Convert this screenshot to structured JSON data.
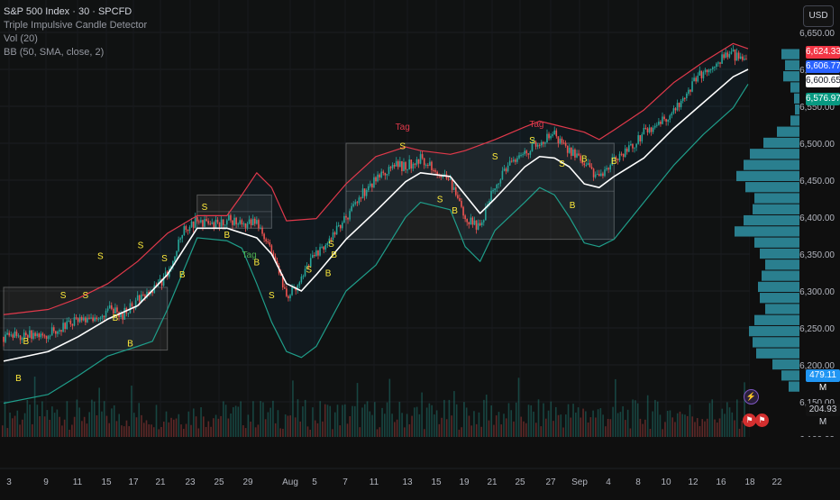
{
  "header": {
    "symbol": "S&P 500 Index · 30 · SPCFD",
    "indicator_1": "Triple Impulsive Candle Detector",
    "indicator_2": "Vol (20)",
    "indicator_3": "BB (50, SMA, close, 2)"
  },
  "currency_button": "USD",
  "price_tags": {
    "high": "6,624.33",
    "last": "6,606.77",
    "mid": "6,600.65",
    "low": "6,576.97",
    "vol_1": "479.11 M",
    "vol_2": "204.93 M"
  },
  "colors": {
    "candle_up": "#26a69a",
    "candle_down": "#ef5350",
    "bb_upper": "#e0394b",
    "bb_lower": "#1f9e8a",
    "bb_basis": "#ffffff",
    "marker_text": "#ffeb3b",
    "tag_text": "#e0394b",
    "volume_profile": "#2a7f8f"
  },
  "icons": [
    "lightning-icon",
    "flag-icon"
  ],
  "chart_data": {
    "type": "candlestick",
    "title": "",
    "ylim": [
      6100,
      6650
    ],
    "y_ticks": [
      "6,650.00",
      "6,600.00",
      "6,550.00",
      "6,500.00",
      "6,450.00",
      "6,400.00",
      "6,350.00",
      "6,300.00",
      "6,250.00",
      "6,200.00",
      "6,150.00",
      "6,100.00"
    ],
    "x_ticks": [
      "3",
      "9",
      "11",
      "15",
      "17",
      "21",
      "23",
      "25",
      "29",
      "Aug",
      "5",
      "7",
      "11",
      "13",
      "15",
      "19",
      "21",
      "25",
      "27",
      "Sep",
      "4",
      "8",
      "10",
      "12",
      "16",
      "18",
      "22"
    ],
    "close_path": [
      [
        0,
        6238
      ],
      [
        3,
        6242
      ],
      [
        5,
        6262
      ],
      [
        6,
        6258
      ],
      [
        7,
        6275
      ],
      [
        8,
        6268
      ],
      [
        9,
        6288
      ],
      [
        10,
        6300
      ],
      [
        11,
        6322
      ],
      [
        12,
        6382
      ],
      [
        13,
        6395
      ],
      [
        14,
        6388
      ],
      [
        15,
        6398
      ],
      [
        16,
        6392
      ],
      [
        17,
        6392
      ],
      [
        18,
        6355
      ],
      [
        19,
        6290
      ],
      [
        20,
        6318
      ],
      [
        21,
        6350
      ],
      [
        22,
        6372
      ],
      [
        23,
        6400
      ],
      [
        24,
        6430
      ],
      [
        25,
        6452
      ],
      [
        26,
        6470
      ],
      [
        27,
        6468
      ],
      [
        28,
        6480
      ],
      [
        29,
        6462
      ],
      [
        30,
        6445
      ],
      [
        31,
        6400
      ],
      [
        32,
        6385
      ],
      [
        33,
        6445
      ],
      [
        34,
        6470
      ],
      [
        35,
        6488
      ],
      [
        36,
        6500
      ],
      [
        37,
        6512
      ],
      [
        38,
        6490
      ],
      [
        39,
        6472
      ],
      [
        40,
        6450
      ],
      [
        41,
        6480
      ],
      [
        42,
        6492
      ],
      [
        43,
        6515
      ],
      [
        44,
        6525
      ],
      [
        45,
        6545
      ],
      [
        46,
        6572
      ],
      [
        47,
        6598
      ],
      [
        48,
        6612
      ],
      [
        49,
        6620
      ],
      [
        50,
        6606
      ]
    ],
    "bb_upper": [
      [
        0,
        6268
      ],
      [
        3,
        6275
      ],
      [
        5,
        6290
      ],
      [
        7,
        6310
      ],
      [
        9,
        6340
      ],
      [
        11,
        6378
      ],
      [
        13,
        6402
      ],
      [
        15,
        6402
      ],
      [
        16,
        6430
      ],
      [
        17,
        6460
      ],
      [
        18,
        6440
      ],
      [
        19,
        6395
      ],
      [
        21,
        6398
      ],
      [
        23,
        6445
      ],
      [
        25,
        6482
      ],
      [
        27,
        6495
      ],
      [
        28,
        6490
      ],
      [
        30,
        6485
      ],
      [
        31,
        6490
      ],
      [
        33,
        6505
      ],
      [
        35,
        6522
      ],
      [
        36,
        6530
      ],
      [
        37,
        6525
      ],
      [
        38,
        6520
      ],
      [
        39,
        6515
      ],
      [
        40,
        6505
      ],
      [
        41,
        6518
      ],
      [
        43,
        6545
      ],
      [
        45,
        6582
      ],
      [
        47,
        6610
      ],
      [
        49,
        6635
      ],
      [
        50,
        6628
      ]
    ],
    "bb_lower": [
      [
        0,
        6148
      ],
      [
        3,
        6160
      ],
      [
        5,
        6185
      ],
      [
        7,
        6212
      ],
      [
        9,
        6225
      ],
      [
        10,
        6232
      ],
      [
        11,
        6275
      ],
      [
        13,
        6372
      ],
      [
        15,
        6368
      ],
      [
        16,
        6358
      ],
      [
        17,
        6310
      ],
      [
        18,
        6258
      ],
      [
        19,
        6218
      ],
      [
        20,
        6210
      ],
      [
        21,
        6225
      ],
      [
        23,
        6300
      ],
      [
        25,
        6335
      ],
      [
        27,
        6400
      ],
      [
        28,
        6420
      ],
      [
        30,
        6410
      ],
      [
        31,
        6360
      ],
      [
        32,
        6340
      ],
      [
        33,
        6382
      ],
      [
        35,
        6420
      ],
      [
        36,
        6440
      ],
      [
        37,
        6430
      ],
      [
        38,
        6400
      ],
      [
        39,
        6365
      ],
      [
        40,
        6360
      ],
      [
        41,
        6370
      ],
      [
        43,
        6420
      ],
      [
        45,
        6470
      ],
      [
        47,
        6512
      ],
      [
        49,
        6548
      ],
      [
        50,
        6580
      ]
    ],
    "bb_basis": [
      [
        0,
        6205
      ],
      [
        3,
        6218
      ],
      [
        5,
        6238
      ],
      [
        7,
        6262
      ],
      [
        9,
        6280
      ],
      [
        11,
        6322
      ],
      [
        13,
        6385
      ],
      [
        15,
        6385
      ],
      [
        17,
        6372
      ],
      [
        18,
        6350
      ],
      [
        19,
        6310
      ],
      [
        20,
        6300
      ],
      [
        21,
        6322
      ],
      [
        23,
        6370
      ],
      [
        25,
        6408
      ],
      [
        27,
        6448
      ],
      [
        28,
        6460
      ],
      [
        30,
        6455
      ],
      [
        31,
        6430
      ],
      [
        32,
        6405
      ],
      [
        33,
        6425
      ],
      [
        35,
        6468
      ],
      [
        36,
        6482
      ],
      [
        37,
        6480
      ],
      [
        38,
        6468
      ],
      [
        39,
        6445
      ],
      [
        40,
        6440
      ],
      [
        41,
        6455
      ],
      [
        43,
        6480
      ],
      [
        45,
        6520
      ],
      [
        47,
        6555
      ],
      [
        49,
        6590
      ],
      [
        50,
        6600
      ]
    ],
    "consolidation_boxes": [
      {
        "x0": 0,
        "x1": 11,
        "y0": 6220,
        "y1": 6305
      },
      {
        "x0": 13,
        "x1": 18,
        "y0": 6385,
        "y1": 6430
      },
      {
        "x0": 23,
        "x1": 41,
        "y0": 6370,
        "y1": 6500
      }
    ],
    "markers": [
      {
        "x": 1,
        "y": 6178,
        "label": "B"
      },
      {
        "x": 1.5,
        "y": 6228,
        "label": "B"
      },
      {
        "x": 4,
        "y": 6290,
        "label": "S"
      },
      {
        "x": 5.5,
        "y": 6290,
        "label": "S"
      },
      {
        "x": 7.5,
        "y": 6260,
        "label": "B"
      },
      {
        "x": 8.5,
        "y": 6225,
        "label": "B"
      },
      {
        "x": 6.5,
        "y": 6343,
        "label": "S"
      },
      {
        "x": 9.2,
        "y": 6358,
        "label": "S"
      },
      {
        "x": 10.8,
        "y": 6340,
        "label": "S"
      },
      {
        "x": 12,
        "y": 6318,
        "label": "B"
      },
      {
        "x": 13.5,
        "y": 6410,
        "label": "S"
      },
      {
        "x": 15,
        "y": 6372,
        "label": "B"
      },
      {
        "x": 17,
        "y": 6335,
        "label": "B"
      },
      {
        "x": 18,
        "y": 6290,
        "label": "S"
      },
      {
        "x": 20.5,
        "y": 6325,
        "label": "S"
      },
      {
        "x": 21.8,
        "y": 6320,
        "label": "B"
      },
      {
        "x": 22.2,
        "y": 6345,
        "label": "B"
      },
      {
        "x": 22,
        "y": 6360,
        "label": "S"
      },
      {
        "x": 26.8,
        "y": 6492,
        "label": "S"
      },
      {
        "x": 29.3,
        "y": 6420,
        "label": "S"
      },
      {
        "x": 30.3,
        "y": 6405,
        "label": "B"
      },
      {
        "x": 33,
        "y": 6478,
        "label": "S"
      },
      {
        "x": 35.5,
        "y": 6500,
        "label": "S"
      },
      {
        "x": 37.5,
        "y": 6468,
        "label": "S"
      },
      {
        "x": 38.2,
        "y": 6412,
        "label": "B"
      },
      {
        "x": 39,
        "y": 6475,
        "label": "B"
      },
      {
        "x": 41,
        "y": 6472,
        "label": "B"
      }
    ],
    "tags": [
      {
        "x": 16.5,
        "y": 6345,
        "label": "Tag"
      },
      {
        "x": 26.8,
        "y": 6518,
        "label": "Tag"
      },
      {
        "x": 35.8,
        "y": 6522,
        "label": "Tag"
      }
    ],
    "volume_profile": [
      {
        "price": 6620,
        "width": 20
      },
      {
        "price": 6605,
        "width": 16
      },
      {
        "price": 6590,
        "width": 18
      },
      {
        "price": 6575,
        "width": 10
      },
      {
        "price": 6560,
        "width": 6
      },
      {
        "price": 6545,
        "width": 5
      },
      {
        "price": 6530,
        "width": 10
      },
      {
        "price": 6515,
        "width": 25
      },
      {
        "price": 6500,
        "width": 40
      },
      {
        "price": 6485,
        "width": 55
      },
      {
        "price": 6470,
        "width": 62
      },
      {
        "price": 6455,
        "width": 70
      },
      {
        "price": 6440,
        "width": 60
      },
      {
        "price": 6425,
        "width": 50
      },
      {
        "price": 6410,
        "width": 52
      },
      {
        "price": 6395,
        "width": 62
      },
      {
        "price": 6380,
        "width": 72
      },
      {
        "price": 6365,
        "width": 50
      },
      {
        "price": 6350,
        "width": 44
      },
      {
        "price": 6335,
        "width": 38
      },
      {
        "price": 6320,
        "width": 42
      },
      {
        "price": 6305,
        "width": 46
      },
      {
        "price": 6290,
        "width": 44
      },
      {
        "price": 6275,
        "width": 38
      },
      {
        "price": 6260,
        "width": 50
      },
      {
        "price": 6245,
        "width": 56
      },
      {
        "price": 6230,
        "width": 52
      },
      {
        "price": 6215,
        "width": 48
      },
      {
        "price": 6200,
        "width": 30
      },
      {
        "price": 6185,
        "width": 20
      },
      {
        "price": 6170,
        "width": 12
      }
    ]
  }
}
